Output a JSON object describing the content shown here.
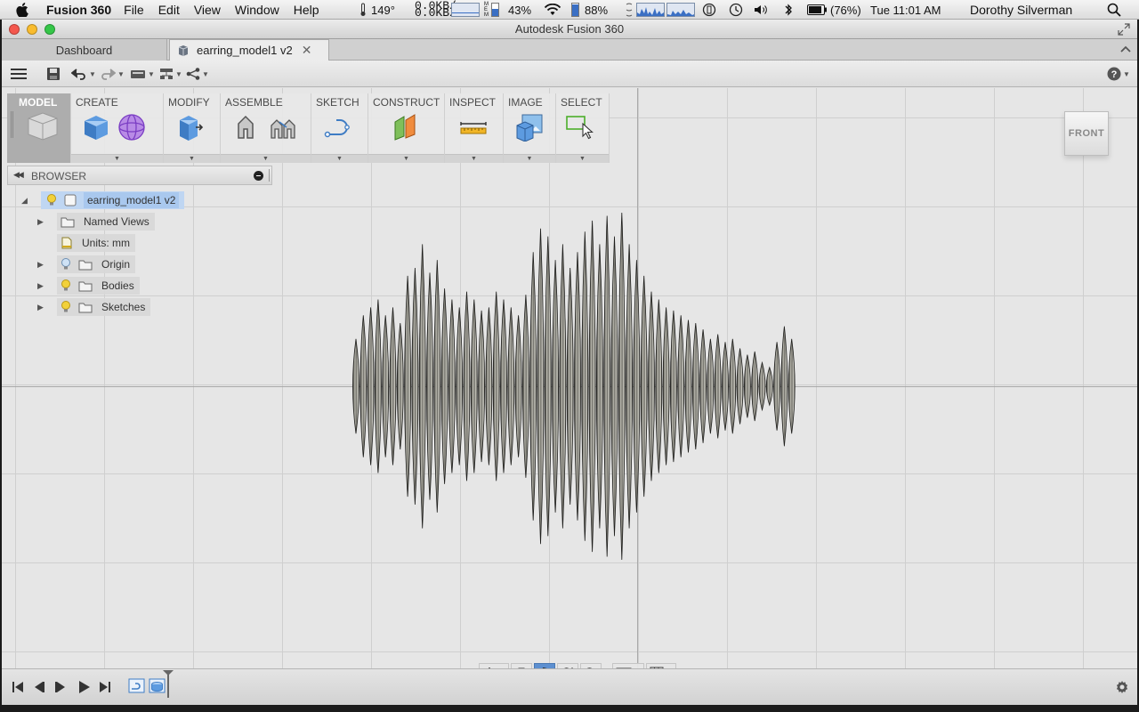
{
  "menubar": {
    "app_name": "Fusion 360",
    "menus": [
      "File",
      "Edit",
      "View",
      "Window",
      "Help"
    ],
    "temperature": "149°",
    "net_up": "0.0KB/s",
    "net_down": "0.0KB/s",
    "memory_label": "MEM",
    "cpu_percent": "43%",
    "battery_level": "88%",
    "battery_status": "(76%)",
    "clock": "Tue 11:01 AM",
    "user": "Dorothy Silverman"
  },
  "window": {
    "title": "Autodesk Fusion 360"
  },
  "tabs": {
    "dashboard": "Dashboard",
    "document": "earring_model1 v2",
    "close_symbol": "✕"
  },
  "toolbar": {
    "model": "MODEL",
    "create": "CREATE",
    "modify": "MODIFY",
    "assemble": "ASSEMBLE",
    "sketch": "SKETCH",
    "construct": "CONSTRUCT",
    "inspect": "INSPECT",
    "image": "IMAGE",
    "select": "SELECT"
  },
  "viewcube": {
    "face": "FRONT"
  },
  "browser": {
    "title": "BROWSER",
    "root": "earring_model1 v2",
    "items": [
      {
        "label": "Named Views"
      },
      {
        "label": "Units: mm"
      },
      {
        "label": "Origin"
      },
      {
        "label": "Bodies"
      },
      {
        "label": "Sketches"
      }
    ]
  },
  "colors": {
    "selection": "#a9c8ee",
    "nav_active": "#5d8fd0",
    "bulb_on": "#f2d13a",
    "bulb_off": "#cfe2f5"
  },
  "model": {
    "wave_bars": [
      0.3,
      0.45,
      0.5,
      0.55,
      0.45,
      0.5,
      0.4,
      0.7,
      0.75,
      0.9,
      0.72,
      0.8,
      0.62,
      0.55,
      0.5,
      0.6,
      0.55,
      0.48,
      0.5,
      0.6,
      0.55,
      0.5,
      0.45,
      0.58,
      0.85,
      1.0,
      0.95,
      0.8,
      0.9,
      0.75,
      0.85,
      0.98,
      1.05,
      0.9,
      1.08,
      0.95,
      1.1,
      0.9,
      0.8,
      0.7,
      0.6,
      0.55,
      0.5,
      0.48,
      0.45,
      0.42,
      0.4,
      0.36,
      0.3,
      0.33,
      0.28,
      0.3,
      0.24,
      0.2,
      0.22,
      0.15,
      0.12,
      0.28,
      0.38,
      0.3
    ]
  }
}
